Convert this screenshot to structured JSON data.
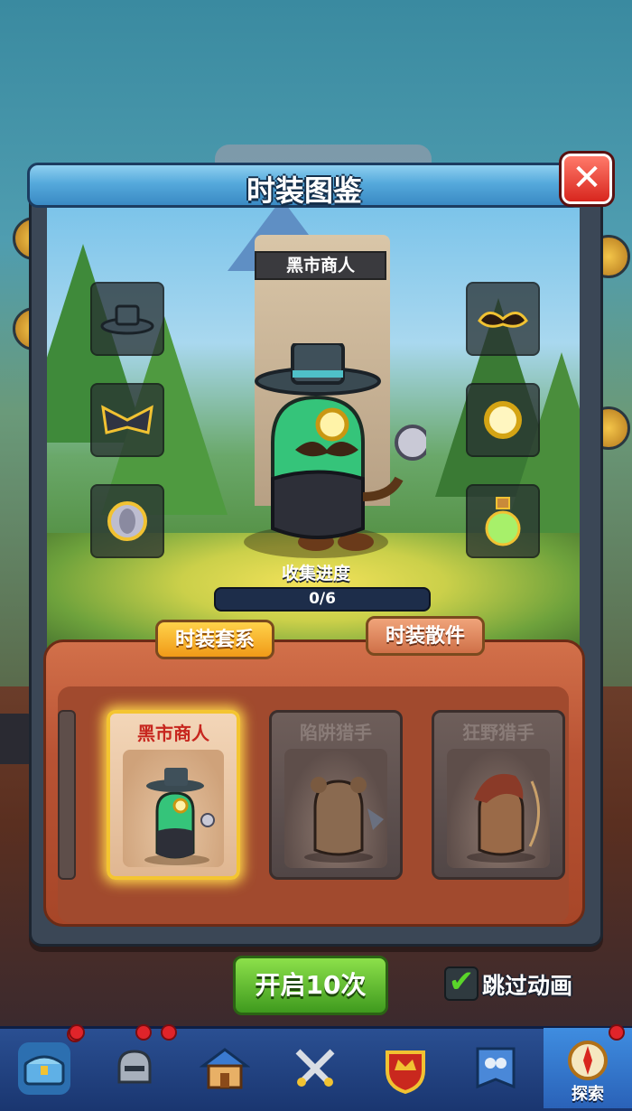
{
  "dialog": {
    "title": "时装图鉴",
    "close_icon": "close-icon"
  },
  "preview": {
    "costume_name": "黑市商人",
    "slots_left": [
      "top-hat-icon",
      "bowtie-collar-icon",
      "silver-coin-icon"
    ],
    "slots_right": [
      "mustache-icon",
      "monocle-icon",
      "potion-bottle-icon"
    ],
    "progress_label": "收集进度",
    "progress_text": "0/6",
    "progress_fraction": 0
  },
  "tabs": [
    {
      "label": "时装套系",
      "active": true
    },
    {
      "label": "时装散件",
      "active": false
    }
  ],
  "cards": [
    {
      "name": "黑市商人",
      "selected": true,
      "art": "black-market-merchant-art"
    },
    {
      "name": "陷阱猎手",
      "selected": false,
      "art": "trap-hunter-art"
    },
    {
      "name": "狂野猎手",
      "selected": false,
      "art": "wild-hunter-art"
    }
  ],
  "actions": {
    "open_button": "开启10次",
    "skip_label": "跳过动画",
    "skip_checked": true
  },
  "nav": {
    "items": [
      {
        "icon": "treasure-chest-icon",
        "badge": true,
        "label": ""
      },
      {
        "icon": "helmet-icon",
        "badge": true,
        "label": ""
      },
      {
        "icon": "house-icon",
        "badge": false,
        "label": ""
      },
      {
        "icon": "crossed-swords-icon",
        "badge": false,
        "label": ""
      },
      {
        "icon": "crown-shield-icon",
        "badge": false,
        "label": ""
      },
      {
        "icon": "team-banner-icon",
        "badge": false,
        "label": ""
      },
      {
        "icon": "compass-icon",
        "badge": true,
        "label": "探索",
        "active": true
      }
    ]
  },
  "colors": {
    "accent_gold": "#f4c531",
    "title_blue": "#55a9dc",
    "selected_name_red": "#c7261e",
    "wood": "#b95334",
    "nav_blue": "#2a4f92"
  }
}
